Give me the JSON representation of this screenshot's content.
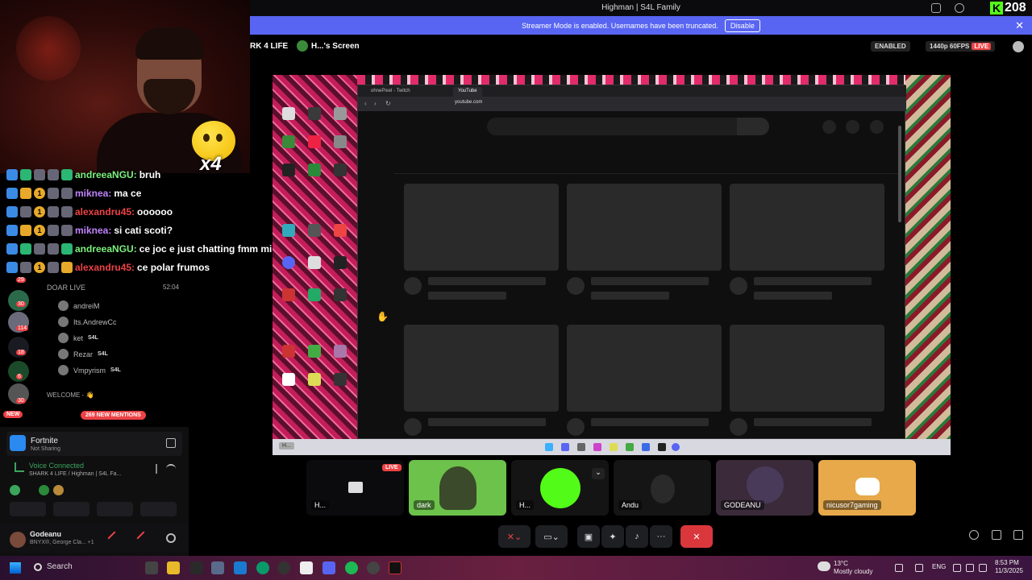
{
  "window": {
    "title": "Highman | S4L Family"
  },
  "kick": {
    "count": "208",
    "logo": "K"
  },
  "banner": {
    "text": "Streamer Mode is enabled. Usernames have been truncated.",
    "disable_label": "Disable",
    "close": "✕",
    "color": "#5865f2"
  },
  "stream_header": {
    "channel": "RK 4 LIFE",
    "screen_label": "H...'s Screen",
    "enabled_label": "ENABLED",
    "quality": "1440p 60FPS",
    "live": "LIVE"
  },
  "overlay": {
    "multiplier": "x4"
  },
  "chat": [
    {
      "user": "andreeaNGU:",
      "user_color": "#7cf07c",
      "msg": "bruh",
      "badge": ""
    },
    {
      "user": "miknea:",
      "user_color": "#c084fc",
      "msg": "ma ce",
      "badge": "1"
    },
    {
      "user": "alexandru45:",
      "user_color": "#ed4245",
      "msg": "oooooo",
      "badge": "1"
    },
    {
      "user": "miknea:",
      "user_color": "#c084fc",
      "msg": "si cati scoti?",
      "badge": "1"
    },
    {
      "user": "andreeaNGU:",
      "user_color": "#7cf07c",
      "msg": "ce joc e just chatting fmm miknea",
      "badge": ""
    },
    {
      "user": "alexandru45:",
      "user_color": "#ed4245",
      "msg": "ce polar frumos",
      "badge": "1"
    }
  ],
  "sidebar": {
    "server_counts": [
      "29",
      "30",
      "114",
      "18",
      "6",
      "30"
    ],
    "new_label": "NEW",
    "mentions": "269 NEW MENTIONS"
  },
  "voice_channel": {
    "name": "DOAR LIVE",
    "time": "52:04",
    "users": [
      {
        "name": "andreiM",
        "tag": ""
      },
      {
        "name": "Its.AndrewCc",
        "tag": ""
      },
      {
        "name": "ket",
        "tag": "S4L"
      },
      {
        "name": "Rezar",
        "tag": "S4L"
      },
      {
        "name": "Vmpyrism",
        "tag": "S4L"
      }
    ],
    "welcome": "WELCOME - 👋"
  },
  "panel": {
    "activity_title": "Fortnite",
    "activity_sub": "Not Sharing",
    "voice_connected": "Voice Connected",
    "voice_path": "SHARK 4 LIFE / Highman | S4L Fa...",
    "user_name": "Godeanu",
    "user_sub": "BNYX®, George Cla...  +1"
  },
  "share": {
    "browser_tabs": [
      "ohnePixel - Twitch",
      "YouTube"
    ],
    "url": "youtube.com",
    "taskbar_label": "H..."
  },
  "participants": [
    {
      "name": "H...",
      "live": "LIVE",
      "color": "#0b0b0d"
    },
    {
      "name": "dark",
      "color": "#6cc24a"
    },
    {
      "name": "H...",
      "color": "#1a1a1a"
    },
    {
      "name": "Andu",
      "color": "#151515"
    },
    {
      "name": "GODEANU",
      "color": "#3a2a3a"
    },
    {
      "name": "nicusor7gaming",
      "color": "#e7a94a"
    }
  ],
  "controls": {
    "more": "···"
  },
  "taskbar": {
    "search": "Search",
    "weather_temp": "13°C",
    "weather_desc": "Mostly cloudy",
    "lang": "ENG",
    "time": "8:53 PM",
    "date": "11/3/2025"
  }
}
